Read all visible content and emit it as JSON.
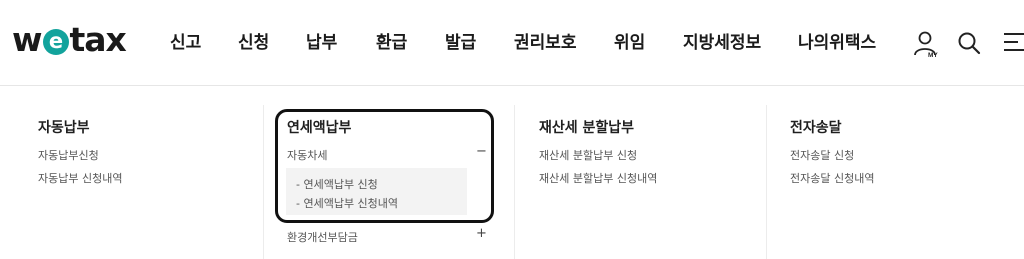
{
  "header": {
    "logo": {
      "prefix": "w",
      "e": "e",
      "suffix": "tax",
      "accent_color": "#12a39c"
    },
    "nav": [
      "신고",
      "신청",
      "납부",
      "환급",
      "발급",
      "권리보호",
      "위임",
      "지방세정보",
      "나의위택스"
    ],
    "util": {
      "my_label": "MY",
      "icons": [
        "user-my-icon",
        "search-icon",
        "menu-icon"
      ]
    }
  },
  "menu": {
    "col1": {
      "title": "자동납부",
      "links": [
        "자동납부신청",
        "자동납부 신청내역"
      ]
    },
    "col2": {
      "title": "연세액납부",
      "group1": {
        "label": "자동차세",
        "toggle": "−",
        "items": [
          "- 연세액납부 신청",
          "- 연세액납부 신청내역"
        ]
      },
      "group2": {
        "label": "환경개선부담금",
        "toggle": "+"
      }
    },
    "col3": {
      "title": "재산세 분할납부",
      "links": [
        "재산세 분할납부 신청",
        "재산세 분할납부 신청내역"
      ]
    },
    "col4": {
      "title": "전자송달",
      "links": [
        "전자송달 신청",
        "전자송달 신청내역"
      ]
    }
  },
  "annotation": {
    "color": "#111111"
  }
}
